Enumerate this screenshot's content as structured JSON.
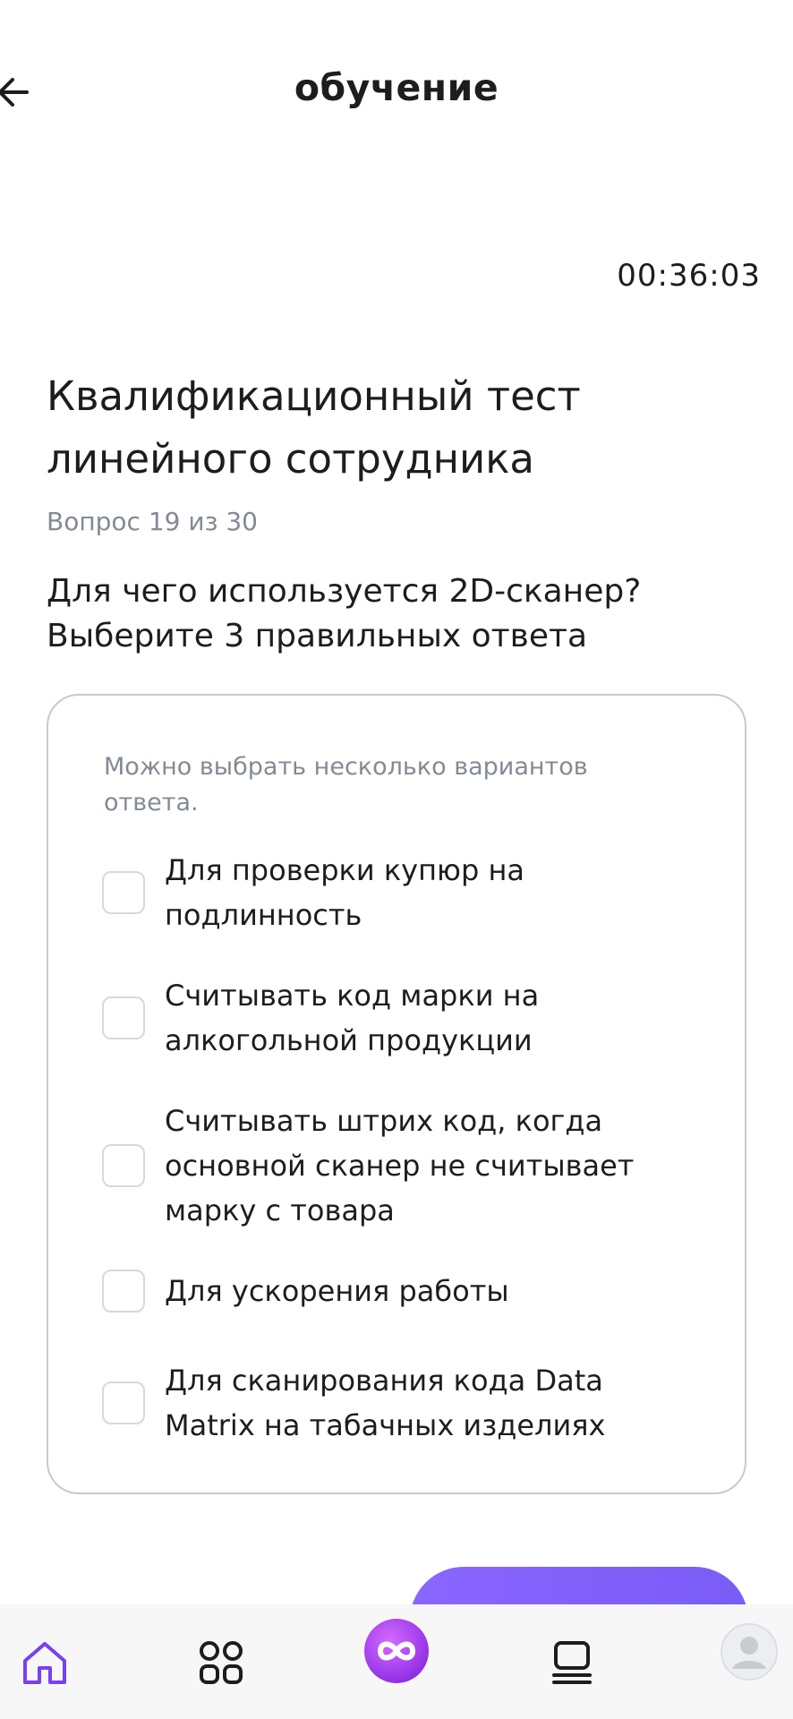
{
  "header": {
    "title": "обучение"
  },
  "timer": "00:36:03",
  "test": {
    "title": "Квалификационный тест линейного сотрудника",
    "counter": "Вопрос 19 из 30",
    "question": "Для чего используется 2D-сканер? Выберите 3 правильных ответа"
  },
  "answers": {
    "hint": "Можно выбрать несколько вариантов ответа.",
    "options": [
      {
        "label": "Для проверки купюр на подлинность",
        "checked": false
      },
      {
        "label": "Считывать код марки на алкогольной продукции",
        "checked": false
      },
      {
        "label": "Считывать штрих код, когда основной сканер не считывает марку с товара",
        "checked": false
      },
      {
        "label": "Для ускорения работы",
        "checked": false
      },
      {
        "label": "Для сканирования кода Data Matrix на табачных изделиях",
        "checked": false
      }
    ]
  },
  "tabbar": {
    "icons": [
      "home-icon",
      "grid-icon",
      "infinity-icon",
      "courses-icon",
      "avatar"
    ],
    "active": "home",
    "accent": "#7a3ff0"
  }
}
